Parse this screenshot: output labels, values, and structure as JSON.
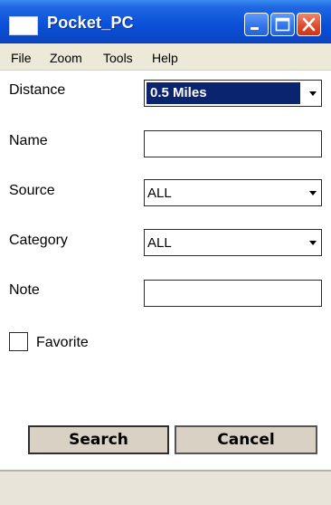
{
  "window": {
    "title": "Pocket_PC"
  },
  "menu": {
    "items": [
      "File",
      "Zoom",
      "Tools",
      "Help"
    ]
  },
  "form": {
    "distance": {
      "label": "Distance",
      "value": "0.5 Miles"
    },
    "name": {
      "label": "Name",
      "value": ""
    },
    "source": {
      "label": "Source",
      "value": "ALL"
    },
    "category": {
      "label": "Category",
      "value": "ALL"
    },
    "note": {
      "label": "Note",
      "value": ""
    },
    "favorite": {
      "label": "Favorite",
      "checked": false
    }
  },
  "buttons": {
    "search": "Search",
    "cancel": "Cancel"
  },
  "colors": {
    "titlebar": "#0a4fd6",
    "selection": "#0a2470",
    "chrome": "#ece9d8",
    "button": "#d9d1c4"
  }
}
